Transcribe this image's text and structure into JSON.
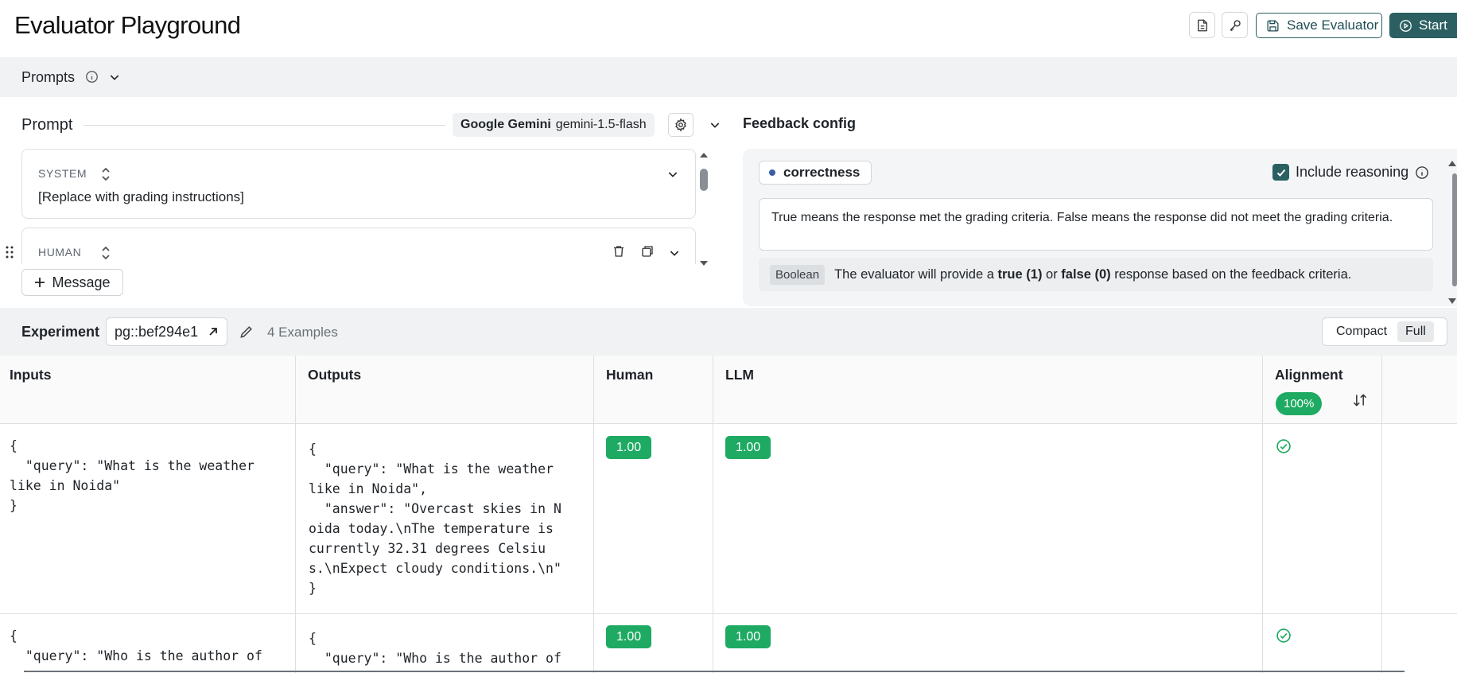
{
  "header": {
    "title": "Evaluator Playground",
    "save_label": "Save Evaluator",
    "start_label": "Start"
  },
  "prompts": {
    "label": "Prompts"
  },
  "prompt": {
    "title": "Prompt",
    "provider": "Google Gemini",
    "model": "gemini-1.5-flash",
    "messages": [
      {
        "role": "SYSTEM",
        "text": "[Replace with grading instructions]"
      },
      {
        "role": "HUMAN",
        "text": ""
      }
    ],
    "add_message_label": "Message"
  },
  "feedback": {
    "title": "Feedback config",
    "criteria_name": "correctness",
    "include_reasoning_label": "Include reasoning",
    "include_reasoning_checked": true,
    "description": "True means the response met the grading criteria. False means the response did not meet the grading criteria.",
    "type_chip": "Boolean",
    "type_text_prefix": "The evaluator will provide a",
    "type_true": "true (1)",
    "type_or": "or",
    "type_false": "false (0)",
    "type_text_suffix": "response based on the feedback criteria."
  },
  "experiment": {
    "label": "Experiment",
    "name": "pg::bef294e1",
    "count": "4 Examples",
    "view_compact": "Compact",
    "view_full": "Full",
    "active_view": "Full"
  },
  "table": {
    "columns": [
      "Inputs",
      "Outputs",
      "Human",
      "LLM",
      "Alignment"
    ],
    "alignment_pct": "100%",
    "rows": [
      {
        "input": "{\n  \"query\": \"What is the weather\nlike in Noida\"\n}",
        "output": "{\n  \"query\": \"What is the weather\nlike in Noida\",\n  \"answer\": \"Overcast skies in N\noida today.\\nThe temperature is\ncurrently 32.31 degrees Celsiu\ns.\\nExpect cloudy conditions.\\n\"\n}",
        "human": "1.00",
        "llm": "1.00",
        "aligned": true
      },
      {
        "input": "{\n  \"query\": \"Who is the author of",
        "output": "{\n  \"query\": \"Who is the author of",
        "human": "1.00",
        "llm": "1.00",
        "aligned": true
      }
    ]
  },
  "colors": {
    "primary": "#2b5f62",
    "success": "#1eaa62",
    "panel_bg": "#f1f2f3"
  }
}
